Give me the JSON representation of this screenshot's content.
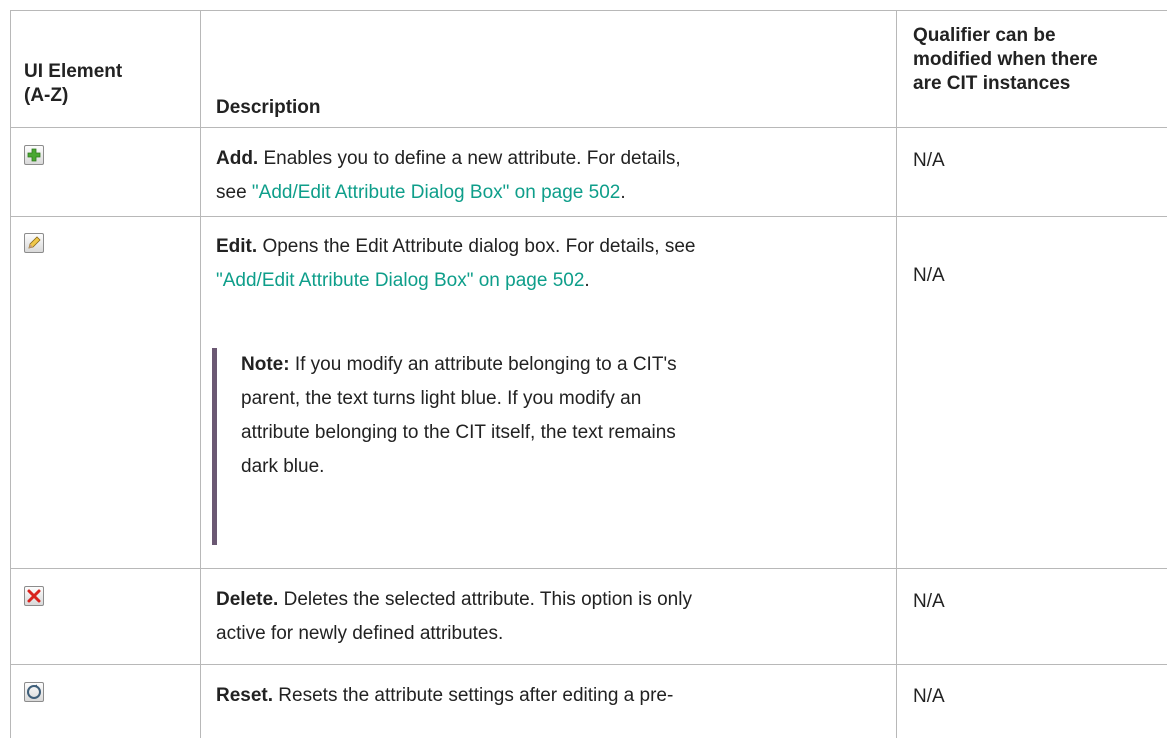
{
  "header": {
    "col1": "UI Element (A-Z)",
    "col1_line1": "UI Element",
    "col1_line2": "(A-Z)",
    "col2": "Description",
    "col3_line1": "Qualifier can be",
    "col3_line2": "modified when there",
    "col3_line3": "are CIT instances"
  },
  "rows": [
    {
      "icon": "add-plus-icon",
      "title": "Add.",
      "text_a": " Enables you to define a new attribute. For details,",
      "text_b": "see ",
      "link": "\"Add/Edit Attribute Dialog Box\" on page 502",
      "text_c": ".",
      "qualifier": "N/A"
    },
    {
      "icon": "edit-pencil-icon",
      "title": "Edit.",
      "text_a": " Opens the Edit Attribute dialog box. For details, see",
      "link": "\"Add/Edit Attribute Dialog Box\" on page 502",
      "text_c": ".",
      "note_label": "Note:",
      "note_l1": "  If you modify an attribute belonging to a CIT's",
      "note_l2": "parent, the text turns light blue. If you modify an",
      "note_l3": "attribute belonging to the CIT itself, the text remains",
      "note_l4": "dark blue.",
      "qualifier": "N/A"
    },
    {
      "icon": "delete-x-icon",
      "title": "Delete.",
      "text_a": " Deletes the selected attribute. This option is only",
      "text_b": "active for newly defined attributes.",
      "qualifier": "N/A"
    },
    {
      "icon": "reset-circle-arrow-icon",
      "title": "Reset.",
      "text_a": " Resets the attribute settings after editing a pre-",
      "qualifier": "N/A"
    }
  ],
  "colors": {
    "link": "#0e9e8a",
    "note_bar": "#6b5873",
    "rule": "#b8b8b8"
  }
}
